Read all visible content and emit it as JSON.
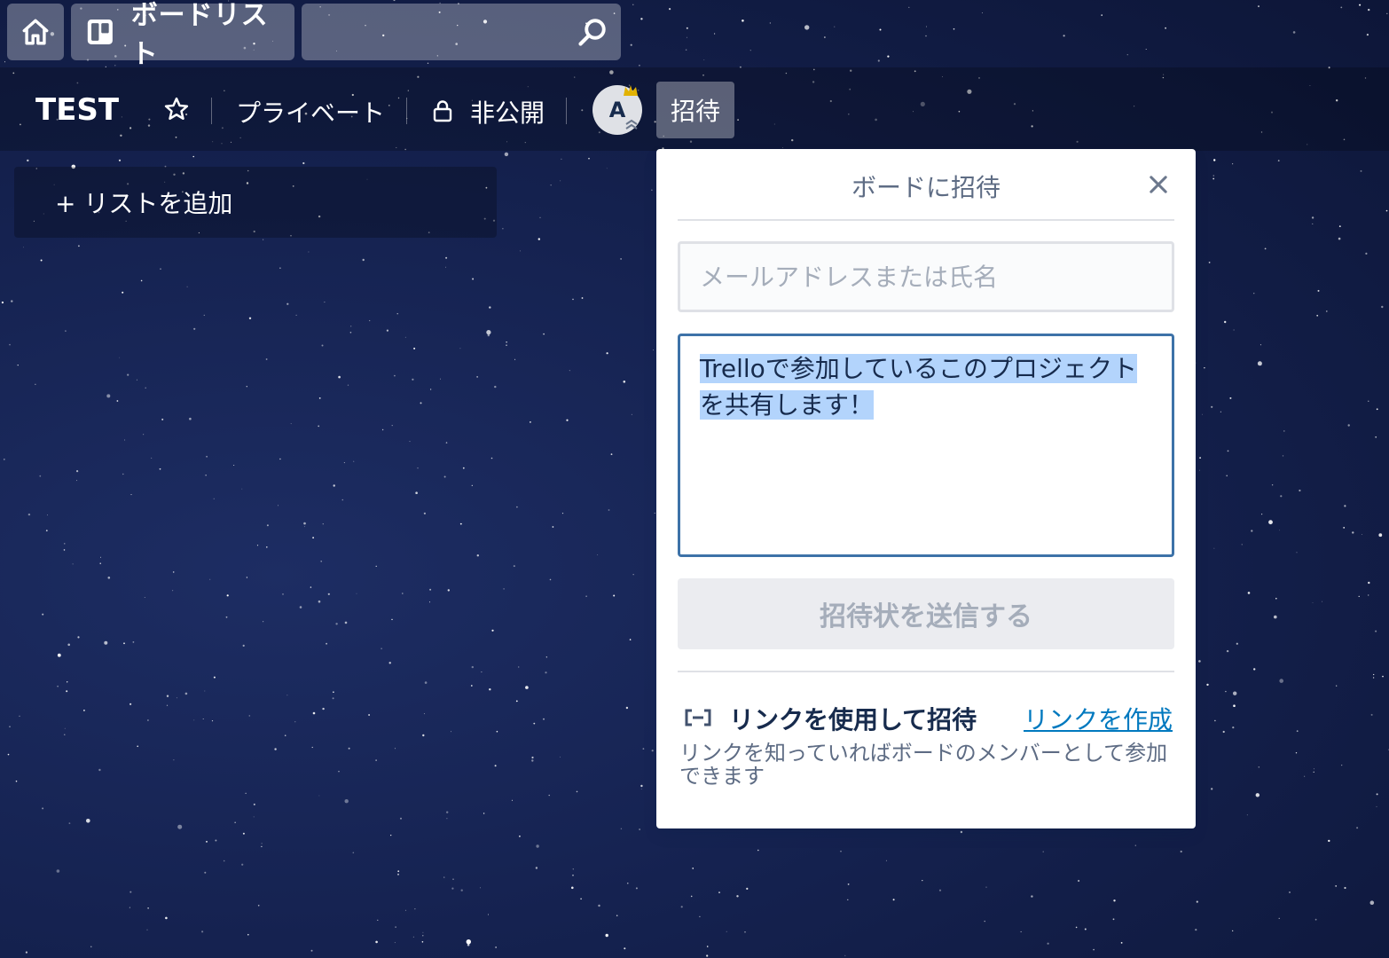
{
  "topbar": {
    "home_icon": "home-icon",
    "boards_icon": "boards-icon",
    "boards_label": "ボードリスト",
    "search_icon": "search-icon",
    "search_value": ""
  },
  "board": {
    "title": "TEST",
    "star_icon": "star-icon",
    "team_visibility": "プライベート",
    "lock_icon": "lock-icon",
    "privacy": "非公開",
    "avatar_initial": "A",
    "invite_label": "招待"
  },
  "lists": {
    "add_list_label": "+ リストを追加"
  },
  "invite_popover": {
    "title": "ボードに招待",
    "close_icon": "close-icon",
    "email_placeholder": "メールアドレスまたは氏名",
    "email_value": "",
    "message_line1": "Trelloで参加しているこのプロジェクト",
    "message_line2": "を共有します！",
    "send_label": "招待状を送信する",
    "link_icon": "link-icon",
    "link_heading": "リンクを使用して招待",
    "create_link_label": "リンクを作成",
    "link_description": "リンクを知っていればボードのメンバーとして参加できます"
  },
  "colors": {
    "background": "#152250",
    "popover_bg": "#ffffff",
    "focus_border": "#3d72a8",
    "selection": "#b3d4fc",
    "link": "#0079bf",
    "avatar_bg": "#dfe1e6",
    "avatar_badge": "#e2b203"
  }
}
